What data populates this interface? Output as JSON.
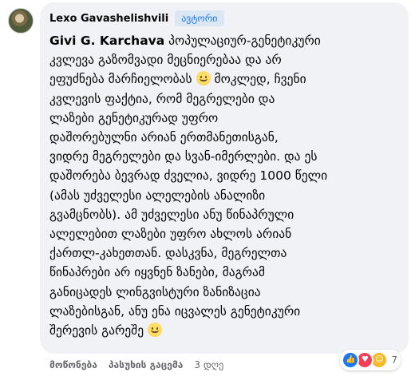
{
  "comment": {
    "author": "Lexo Gavashelishvili",
    "badge": "ავტორი",
    "mention": "Givi G. Karchava",
    "lines": [
      " პოპულაციურ-გენეტიკური",
      "კვლევა გაზომვადი მეცნიერებაა და არ",
      "ეფუძნება მარჩიელობას ",
      " მოკლედ, ჩვენი",
      "კვლევის ფაქტია, რომ მეგრელები და",
      "ლაზები გენეტიკურად უფრო",
      "დაშორებულნი არიან ერთმანეთისგან,",
      "ვიდრე მეგრელები და სვან-იმერლები. და ეს",
      "დაშორება ბევრად ძველია, ვიდრე 1000 წელი",
      "(ამას უძველესი ალელების ანალიზი",
      "გვამცნობს). ამ უძველესი ანუ წინაპრული",
      "ალელებით ლაზები უფრო ახლოს არიან",
      "ქართლ-კახეთთან. დასკვნა, მეგრელთა",
      "წინაპრები არ იყვნენ ზანები, მაგრამ",
      "განიცადეს ლინგვისტური ზანიზაცია",
      "ლაზებისგან, ანუ ენა იცვალეს გენეტიკური",
      "შერევის გარეშე "
    ],
    "emoji_icon": "smiling-face-emoji"
  },
  "actions": {
    "like": "მოწონება",
    "reply": "პასუხის გაცემა",
    "time": "3 დღე"
  },
  "reactions": {
    "icons": [
      "like-icon",
      "love-icon",
      "care-icon"
    ],
    "count": "7"
  }
}
